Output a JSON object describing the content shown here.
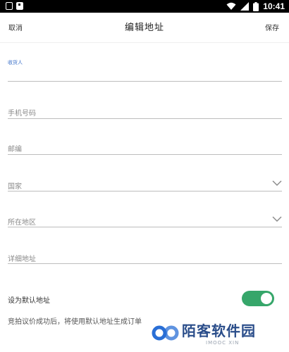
{
  "status_bar": {
    "time": "10:41"
  },
  "header": {
    "cancel_label": "取消",
    "title": "编辑地址",
    "save_label": "保存"
  },
  "form": {
    "recipient_label": "收货人",
    "phone_label": "手机号码",
    "postcode_label": "邮编",
    "country_label": "国家",
    "region_label": "所在地区",
    "address_detail_label": "详细地址",
    "default_label": "设为默认地址",
    "default_enabled": true
  },
  "note": "竞拍议价成功后，将使用默认地址生成订单",
  "watermark": {
    "brand": "陌客软件园",
    "sub": "IMOOC XIN"
  },
  "colors": {
    "toggle_on": "#36a66a",
    "label_accent": "#3a6fc8"
  }
}
